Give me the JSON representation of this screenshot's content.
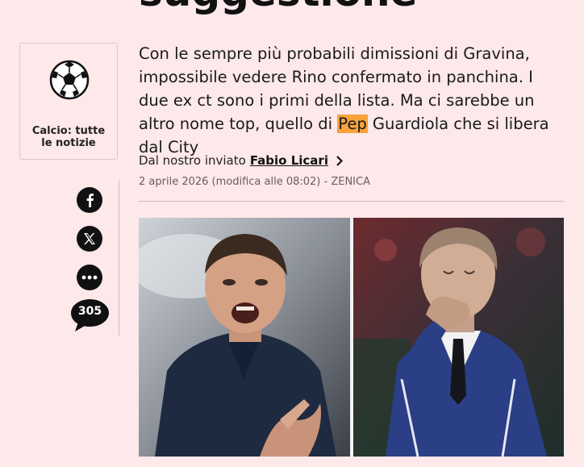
{
  "article": {
    "headline": "suggestione",
    "summary_before": "Con le sempre più probabili dimissioni di Gravina, impossibile vedere Rino confermato in panchina. I due ex ct sono i primi della lista. Ma ci sarebbe un altro nome top, quello di ",
    "summary_highlight": "Pep",
    "summary_after": " Guardiola che si libera dal City",
    "byline_prefix": "Dal nostro inviato",
    "author": "Fabio Licari",
    "dateline": "2 aprile 2026 (modifica alle 08:02) - ZENICA"
  },
  "category": {
    "icon": "soccer-ball-icon",
    "label": "Calcio: tutte le notizie"
  },
  "social": {
    "facebook_icon": "facebook-icon",
    "x_icon": "x-icon",
    "more_icon": "more-icon",
    "comments_icon": "comment-bubble-icon",
    "comments_count": "305"
  },
  "colors": {
    "background": "#fde8ea",
    "highlight": "#f7a23b",
    "icon_dark": "#111111"
  }
}
